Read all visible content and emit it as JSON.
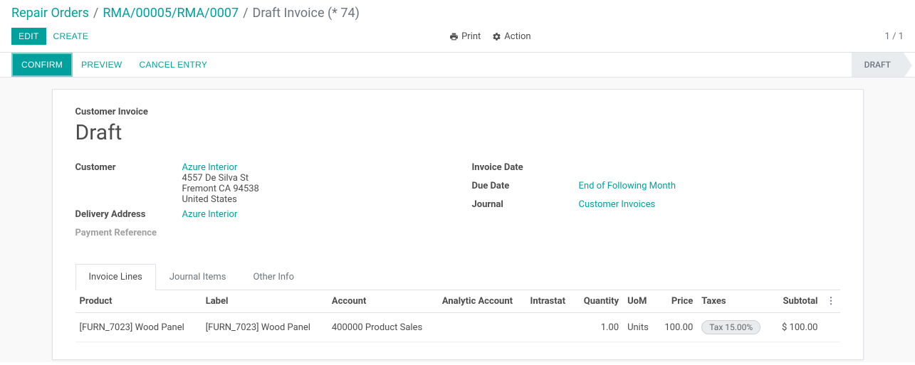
{
  "breadcrumb": {
    "root": "Repair Orders",
    "path": "RMA/00005/RMA/0007",
    "current": "Draft Invoice (* 74)"
  },
  "controls": {
    "edit": "Edit",
    "create": "Create",
    "print": "Print",
    "action": "Action"
  },
  "pager": {
    "current": "1",
    "total": "1"
  },
  "statusbar": {
    "confirm": "Confirm",
    "preview": "Preview",
    "cancel": "Cancel Entry",
    "status": "Draft"
  },
  "form": {
    "section_title": "Customer Invoice",
    "title": "Draft",
    "left": {
      "customer_label": "Customer",
      "customer_name": "Azure Interior",
      "address_line1": "4557 De Silva St",
      "address_line2": "Fremont CA 94538",
      "address_country": "United States",
      "delivery_label": "Delivery Address",
      "delivery_value": "Azure Interior",
      "payment_ref_label": "Payment Reference"
    },
    "right": {
      "invoice_date_label": "Invoice Date",
      "invoice_date_value": "",
      "due_date_label": "Due Date",
      "due_date_value": "End of Following Month",
      "journal_label": "Journal",
      "journal_value": "Customer Invoices"
    }
  },
  "tabs": {
    "invoice_lines": "Invoice Lines",
    "journal_items": "Journal Items",
    "other_info": "Other Info"
  },
  "table": {
    "headers": {
      "product": "Product",
      "label": "Label",
      "account": "Account",
      "analytic": "Analytic Account",
      "intrastat": "Intrastat",
      "quantity": "Quantity",
      "uom": "UoM",
      "price": "Price",
      "taxes": "Taxes",
      "subtotal": "Subtotal"
    },
    "rows": [
      {
        "product": "[FURN_7023] Wood Panel",
        "label": "[FURN_7023] Wood Panel",
        "account": "400000 Product Sales",
        "analytic": "",
        "intrastat": "",
        "quantity": "1.00",
        "uom": "Units",
        "price": "100.00",
        "taxes": "Tax 15.00%",
        "subtotal": "$ 100.00"
      }
    ]
  }
}
